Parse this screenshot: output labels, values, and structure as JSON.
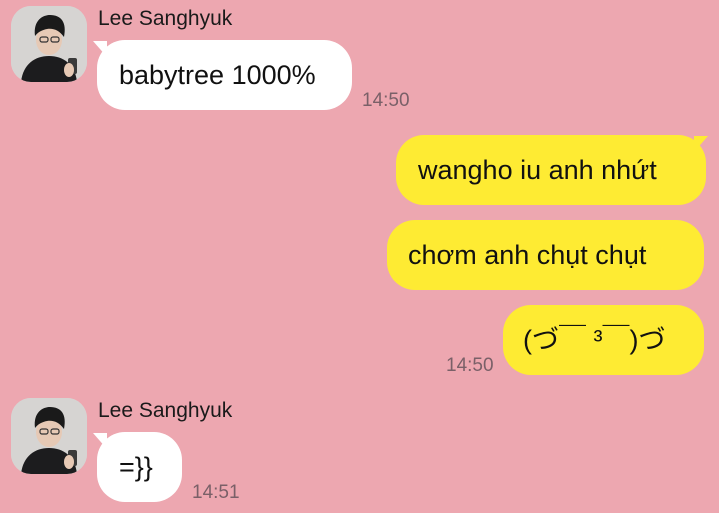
{
  "theme": {
    "background": "#EDA7B0",
    "incoming_bubble": "#FFFFFF",
    "outgoing_bubble": "#FEEB33",
    "timestamp_color": "#7A6068"
  },
  "conversation": {
    "groups": [
      {
        "direction": "incoming",
        "sender": "Lee Sanghyuk",
        "avatar_icon": "profile-photo",
        "messages": [
          {
            "text": "babytree 1000%",
            "time": "14:50"
          }
        ]
      },
      {
        "direction": "outgoing",
        "messages": [
          {
            "text": "wangho iu anh nhứt"
          },
          {
            "text": "chơm anh chụt chụt"
          },
          {
            "text": "(づ￣ ³￣)づ",
            "time": "14:50"
          }
        ]
      },
      {
        "direction": "incoming",
        "sender": "Lee Sanghyuk",
        "avatar_icon": "profile-photo",
        "messages": [
          {
            "text": "=}}",
            "time": "14:51"
          }
        ]
      }
    ]
  }
}
